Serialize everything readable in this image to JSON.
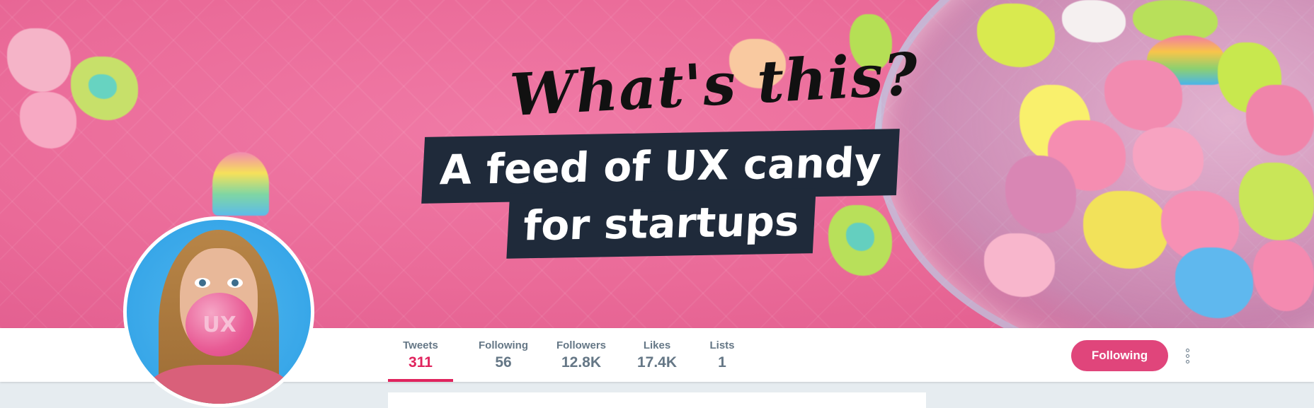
{
  "banner": {
    "script_title": "What's this?",
    "tagline_line1": "A feed of UX candy",
    "tagline_line2": "for startups"
  },
  "avatar": {
    "bubble_text": "UX"
  },
  "stats": [
    {
      "label": "Tweets",
      "value": "311",
      "active": true
    },
    {
      "label": "Following",
      "value": "56",
      "active": false
    },
    {
      "label": "Followers",
      "value": "12.8K",
      "active": false
    },
    {
      "label": "Likes",
      "value": "17.4K",
      "active": false
    },
    {
      "label": "Lists",
      "value": "1",
      "active": false
    }
  ],
  "actions": {
    "follow_label": "Following",
    "more_icon": "more-vertical-icon"
  },
  "colors": {
    "accent": "#e0245e",
    "button": "#e0457b",
    "stat_text": "#657786",
    "banner_pink": "#ea6a98",
    "tagline_bg": "#1f2a3a"
  }
}
